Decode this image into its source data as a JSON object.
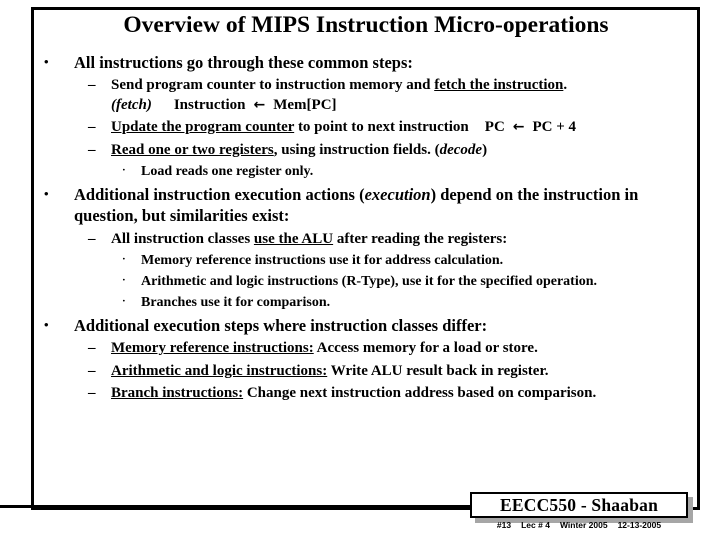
{
  "slide": {
    "title": "Overview of MIPS Instruction Micro-operations",
    "bullets": {
      "b1": "All instructions go through these common steps:",
      "b1_1_pre": "Send program counter to instruction memory and ",
      "b1_1_u": "fetch the instruction",
      "b1_1_post": ".",
      "b1_1_cont_label": "(fetch)",
      "b1_1_cont_lhs": "Instruction",
      "b1_1_cont_arrow": "←",
      "b1_1_cont_rhs": "Mem[PC]",
      "b1_2_u": "Update the program counter",
      "b1_2_post": " to point to next instruction",
      "b1_2_pc_lhs": "PC",
      "b1_2_pc_arrow": "←",
      "b1_2_pc_rhs": "PC + 4",
      "b1_3_u": "Read one or two registers",
      "b1_3_mid": ", using instruction fields. (",
      "b1_3_i": "decode",
      "b1_3_post": ")",
      "b1_3_1": "Load reads one register only.",
      "b2_pre": "Additional instruction execution actions (",
      "b2_i": "execution",
      "b2_post": ") depend on the instruction in question, but similarities exist:",
      "b2_1_pre": "All instruction classes ",
      "b2_1_u": "use the ALU",
      "b2_1_post": " after reading the registers:",
      "b2_1_1": "Memory reference instructions use it for address calculation.",
      "b2_1_2": "Arithmetic and logic instructions (R-Type),  use it for the specified operation.",
      "b2_1_3": "Branches use it for comparison.",
      "b3": "Additional execution steps where instruction classes differ:",
      "b3_1_u": "Memory reference instructions:",
      "b3_1_post": "  Access memory for a load or store.",
      "b3_2_u": "Arithmetic and logic instructions:",
      "b3_2_post": "  Write ALU result back in register.",
      "b3_3_u": "Branch instructions:",
      "b3_3_post": "  Change next instruction address based on comparison."
    },
    "markers": {
      "level1_bullet": "•",
      "level2_bullet": "–",
      "level3_bullet": "·"
    },
    "footer": {
      "badge_text": "EECC550 - Shaaban",
      "slide_number": "#13",
      "lecture": "Lec # 4",
      "term": "Winter 2005",
      "date": "12-13-2005"
    },
    "colors": {
      "text": "#000000",
      "background": "#ffffff",
      "border": "#000000",
      "badge_shadow": "#a6a6a6"
    }
  }
}
